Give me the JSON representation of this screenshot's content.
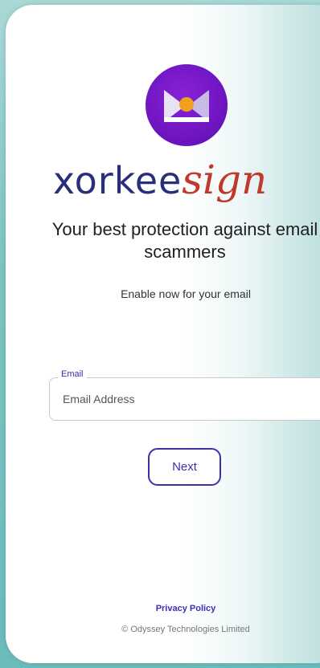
{
  "brand": {
    "name_part1": "xorkee",
    "name_part2": "sign"
  },
  "headline": "Your best protection against email scammers",
  "subheadline": "Enable now for your email",
  "email_field": {
    "label": "Email",
    "placeholder": "Email Address",
    "value": ""
  },
  "next_button": {
    "label": "Next"
  },
  "footer": {
    "privacy_link": "Privacy Policy",
    "copyright": "© Odyssey Technologies Limited"
  },
  "colors": {
    "accent": "#3f2ea8",
    "logo_purple": "#7a1ad0",
    "brand_navy": "#2a2f7a",
    "brand_red": "#c0392b"
  }
}
